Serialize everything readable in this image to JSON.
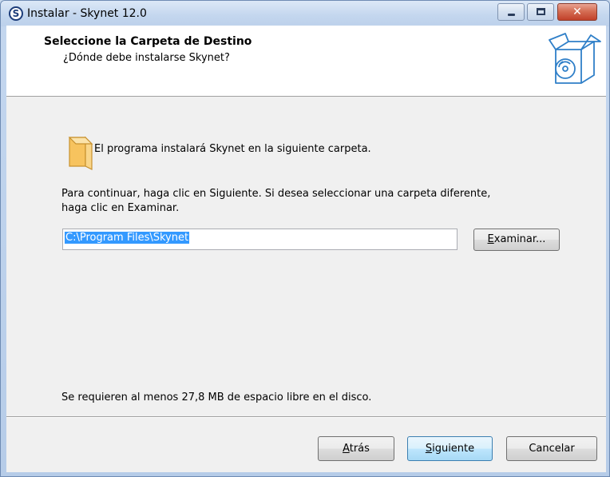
{
  "window": {
    "title": "Instalar - Skynet 12.0",
    "app_icon_letter": "S",
    "controls": {
      "minimize": "minimize-icon",
      "maximize": "maximize-icon",
      "close": "✕"
    }
  },
  "header": {
    "title": "Seleccione la Carpeta de Destino",
    "subtitle": "¿Dónde debe instalarse Skynet?"
  },
  "body": {
    "folder_message": "El programa instalará Skynet en la siguiente carpeta.",
    "instruction_line1": "Para continuar, haga clic en Siguiente. Si desea seleccionar una carpeta diferente,",
    "instruction_line2": "haga clic en Examinar.",
    "path_value": "C:\\Program Files\\Skynet",
    "browse_label_accel": "E",
    "browse_label_rest": "xaminar...",
    "space_required": "Se requieren al menos 27,8 MB de espacio libre en el disco."
  },
  "footer": {
    "back_accel": "A",
    "back_rest": "trás",
    "next_accel": "S",
    "next_rest": "iguiente",
    "cancel_label": "Cancelar"
  },
  "colors": {
    "selection": "#3399ff",
    "close_button": "#c1412a",
    "dialog_bg": "#f0f0f0"
  }
}
